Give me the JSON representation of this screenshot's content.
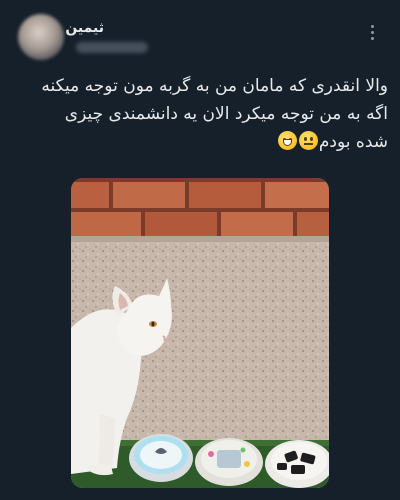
{
  "tweet": {
    "author_name": "ثیمین",
    "text_lines": [
      "والا انقدری که مامان من به گربه مون توجه میکنه",
      "اگه به من توجه میکرد الان یه دانشمندی چیزی",
      "شده بودم"
    ],
    "emojis": [
      "neutral-face-emoji",
      "grinning-face-emoji"
    ]
  },
  "colors": {
    "background": "#15202b",
    "text": "#e7e9ea",
    "muted": "#8b98a5"
  }
}
